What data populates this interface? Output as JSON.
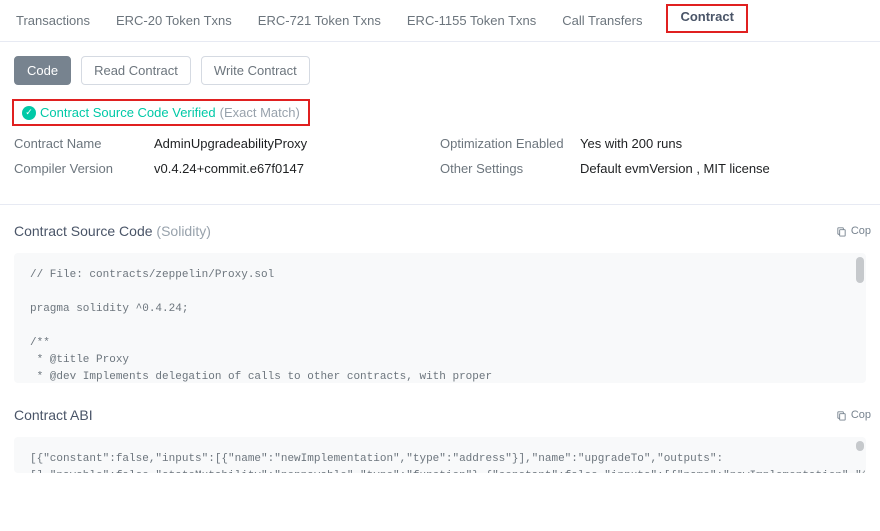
{
  "tabs": {
    "transactions": "Transactions",
    "erc20": "ERC-20 Token Txns",
    "erc721": "ERC-721 Token Txns",
    "erc1155": "ERC-1155 Token Txns",
    "calls": "Call Transfers",
    "contract": "Contract"
  },
  "subnav": {
    "code": "Code",
    "read": "Read Contract",
    "write": "Write Contract"
  },
  "verified": {
    "text": "Contract Source Code Verified",
    "match": "(Exact Match)"
  },
  "meta": {
    "contract_name_label": "Contract Name",
    "contract_name_value": "AdminUpgradeabilityProxy",
    "compiler_label": "Compiler Version",
    "compiler_value": "v0.4.24+commit.e67f0147",
    "opt_label": "Optimization Enabled",
    "opt_value": "Yes with 200 runs",
    "other_label": "Other Settings",
    "other_value": "Default evmVersion , MIT license"
  },
  "sections": {
    "source_title": "Contract Source Code",
    "source_lang": "(Solidity)",
    "abi_title": "Contract ABI",
    "copy": "Cop"
  },
  "source_code": "// File: contracts/zeppelin/Proxy.sol\n\npragma solidity ^0.4.24;\n\n/**\n * @title Proxy\n * @dev Implements delegation of calls to other contracts, with proper\n * forwarding of return values and bubbling of failures.\n * It defines a fallback function that delegates all calls to the address",
  "abi_code": "[{\"constant\":false,\"inputs\":[{\"name\":\"newImplementation\",\"type\":\"address\"}],\"name\":\"upgradeTo\",\"outputs\":\n[],\"payable\":false,\"stateMutability\":\"nonpayable\",\"type\":\"function\"},{\"constant\":false,\"inputs\":[{\"name\":\"newImplementation\",\"type\":\"address\"},\n{\"name\":\"data\",\"type\":\"bytes\"}],\"name\":\"upgradeToAndCall\",\"outputs\":[],\"payable\":true,\"stateMutability\":\"payable\",\"type\":\"function\"},{\"constant\":true,\"inputs\":"
}
